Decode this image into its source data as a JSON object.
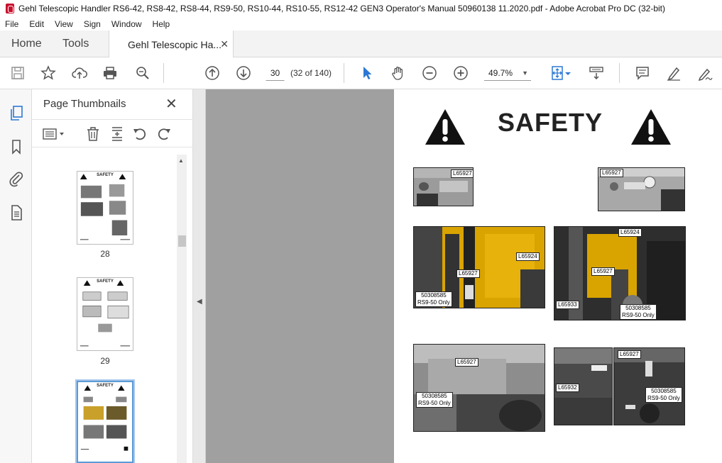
{
  "window": {
    "title": "Gehl Telescopic Handler RS6-42, RS8-42, RS8-44, RS9-50, RS10-44, RS10-55, RS12-42 GEN3 Operator's Manual 50960138 11.2020.pdf - Adobe Acrobat Pro DC (32-bit)"
  },
  "menu": [
    "File",
    "Edit",
    "View",
    "Sign",
    "Window",
    "Help"
  ],
  "tabs": {
    "home": "Home",
    "tools": "Tools",
    "doc": "Gehl Telescopic Ha...",
    "close": "✕"
  },
  "toolbar": {
    "page_number": "30",
    "page_count": "(32 of 140)",
    "zoom": "49.7%"
  },
  "thumbnails_panel": {
    "title": "Page Thumbnails",
    "close": "✕",
    "pages": [
      {
        "number": "28",
        "heading": "SAFETY"
      },
      {
        "number": "29",
        "heading": "SAFETY"
      },
      {
        "number": "",
        "heading": "SAFETY"
      }
    ]
  },
  "document_page": {
    "heading": "SAFETY",
    "labels": {
      "top_left": "L65927",
      "top_right": "L65927",
      "mid_left_a": "L65924",
      "mid_left_b": "L65927",
      "mid_left_c1": "50308585",
      "mid_left_c2": "RS9-50 Only",
      "mid_right_a": "L65924",
      "mid_right_b": "L65927",
      "mid_right_c": "L65933",
      "mid_right_d1": "50308585",
      "mid_right_d2": "RS9-50 Only",
      "bot_left_a": "L65927",
      "bot_left_b1": "50308585",
      "bot_left_b2": "RS9-50 Only",
      "bot_right_a": "L65927",
      "bot_right_b": "L65932",
      "bot_right_c1": "50308585",
      "bot_right_c2": "RS9-50 Only"
    }
  },
  "colors": {
    "accent_blue": "#2b78d4",
    "machine_yellow": "#e8b400",
    "viewer_gray": "#a0a0a0"
  }
}
